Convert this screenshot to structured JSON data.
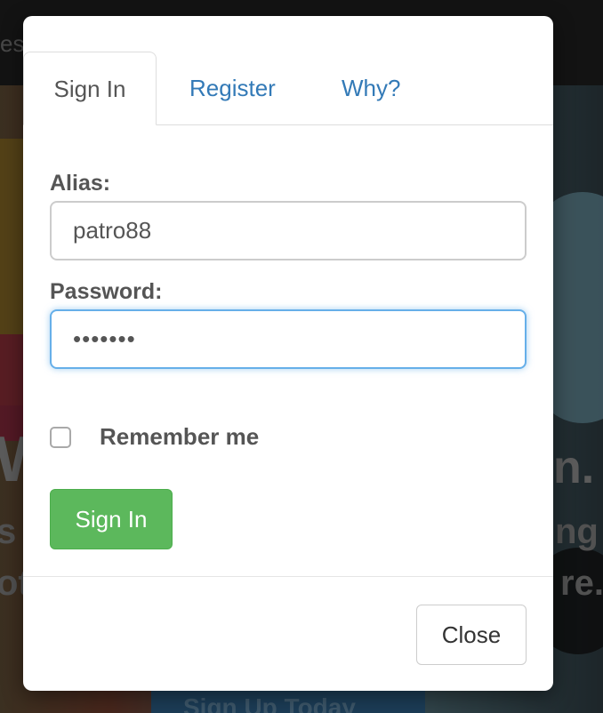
{
  "background": {
    "topbar_fragment": "est",
    "hero_fragments": [
      "W",
      "n.",
      "s",
      "ng",
      "ot",
      "re."
    ],
    "cta_label": "Sign Up Today"
  },
  "modal": {
    "tabs": [
      {
        "label": "Sign In",
        "active": true
      },
      {
        "label": "Register",
        "active": false
      },
      {
        "label": "Why?",
        "active": false
      }
    ],
    "form": {
      "alias_label": "Alias:",
      "alias_value": "patro88",
      "password_label": "Password:",
      "password_value": "•••••••",
      "remember_label": "Remember me",
      "remember_checked": false,
      "submit_label": "Sign In"
    },
    "footer": {
      "close_label": "Close"
    }
  },
  "colors": {
    "primary_link": "#337ab7",
    "success": "#5cb85c",
    "focus": "#66afe9"
  }
}
